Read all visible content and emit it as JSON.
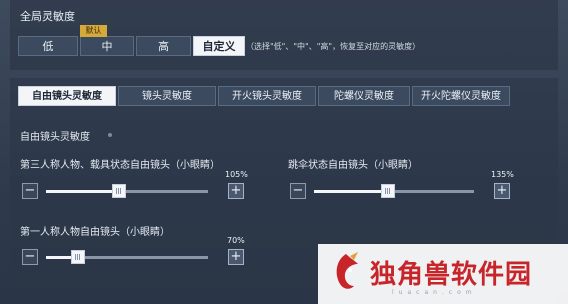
{
  "global": {
    "title": "全局灵敏度",
    "options": [
      "低",
      "中",
      "高",
      "自定义"
    ],
    "selected": 3,
    "default_tag": "默认",
    "hint": "（选择\"低\"、\"中\"、\"高\"，恢复至对应的灵敏度）"
  },
  "tabs": {
    "items": [
      "自由镜头灵敏度",
      "镜头灵敏度",
      "开火镜头灵敏度",
      "陀螺仪灵敏度",
      "开火陀螺仪灵敏度"
    ],
    "selected": 0
  },
  "section": {
    "title": "自由镜头灵敏度"
  },
  "sliders": [
    {
      "label": "第三人称人物、载具状态自由镜头（小眼睛）",
      "value_label": "105%",
      "fraction": 0.45
    },
    {
      "label": "跳伞状态自由镜头（小眼睛）",
      "value_label": "135%",
      "fraction": 0.46
    },
    {
      "label": "第一人称人物自由镜头（小眼睛）",
      "value_label": "70%",
      "fraction": 0.2
    }
  ],
  "buttons": {
    "minus": "−",
    "plus": "+"
  },
  "watermark": {
    "text": "独角兽软件园",
    "url": "luacan.com"
  },
  "colors": {
    "selected_bg": "#f3f5f8",
    "default_tag": "#d6a93b",
    "watermark_red": "#c8252a"
  }
}
